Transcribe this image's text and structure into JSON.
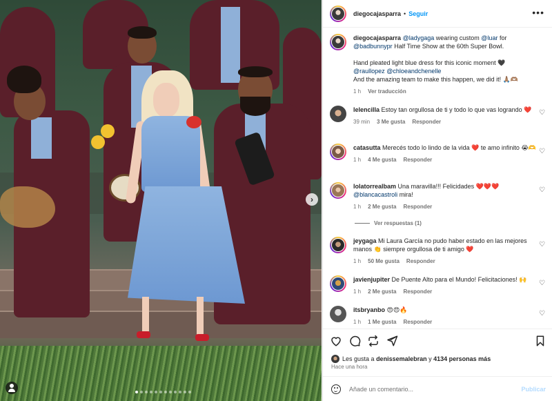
{
  "header": {
    "username": "diegocajasparra",
    "separator": "•",
    "follow_label": "Seguir",
    "more_icon": "more-horizontal-icon"
  },
  "caption": {
    "username": "diegocajasparra",
    "mention1": "@ladygaga",
    "text1": "wearing custom",
    "mention2": "@luar",
    "text2": "for",
    "mention3": "@badbunnypr",
    "text3": "Half Time Show at the 60th Super Bowl.",
    "line2": "Hand pleated light blue dress for this iconic moment 🖤",
    "mention4": "@raullopez",
    "mention5": "@chloeandchenelle",
    "line4": "And the amazing team to make this happen, we did it! 🙏🏽🫶🏽",
    "time": "1 h",
    "translate_label": "Ver traducción"
  },
  "comments": [
    {
      "username": "lelencilla",
      "text": "Estoy tan orgullosa de ti y todo lo que vas logrando",
      "emoji": "❤️",
      "time": "39 min",
      "likes": "3 Me gusta",
      "reply_label": "Responder"
    },
    {
      "username": "catasutta",
      "text": "Merecés todo lo lindo de la vida",
      "emoji_mid": "❤️",
      "text_after": "te amo infinito",
      "emoji_end": "😭🫶",
      "time": "1 h",
      "likes": "4 Me gusta",
      "reply_label": "Responder"
    },
    {
      "username": "lolatorrealbam",
      "text": "Una maravilla!!! Felicidades",
      "emoji": "❤️❤️❤️",
      "mention": "@blancacastroli",
      "text2": "mira!",
      "time": "1 h",
      "likes": "2 Me gusta",
      "reply_label": "Responder"
    },
    {
      "username": "jeygaga",
      "text": "Mi Laura García no pudo haber estado en las mejores manos",
      "emoji_mid": "👏",
      "text_after": "siempre orgullosa de ti amigo",
      "emoji_end": "❤️",
      "time": "1 h",
      "likes": "50 Me gusta",
      "reply_label": "Responder"
    },
    {
      "username": "javienjupiter",
      "text": "De Puente Alto para el Mundo! Felicitaciones!",
      "emoji": "🙌",
      "time": "1 h",
      "likes": "2 Me gusta",
      "reply_label": "Responder"
    },
    {
      "username": "itsbryanbo",
      "text": "",
      "emoji": "😍😍🔥",
      "time": "1 h",
      "likes": "1 Me gusta",
      "reply_label": "Responder"
    }
  ],
  "view_replies_label": "Ver respuestas (1)",
  "actions": {
    "like_icon": "heart-icon",
    "comment_icon": "comment-icon",
    "share_icon": "repost-icon",
    "send_icon": "send-icon",
    "save_icon": "bookmark-icon"
  },
  "likes": {
    "prefix": "Les gusta a",
    "user": "denissemalebran",
    "middle": "y",
    "count": "4134 personas más"
  },
  "post_time": "Hace una hora",
  "add_comment": {
    "placeholder": "Añade un comentario...",
    "post_label": "Publicar"
  },
  "colors": {
    "link": "#00376b",
    "follow": "#0095f6",
    "post_disabled": "#b3dbff",
    "meta": "#737373"
  }
}
